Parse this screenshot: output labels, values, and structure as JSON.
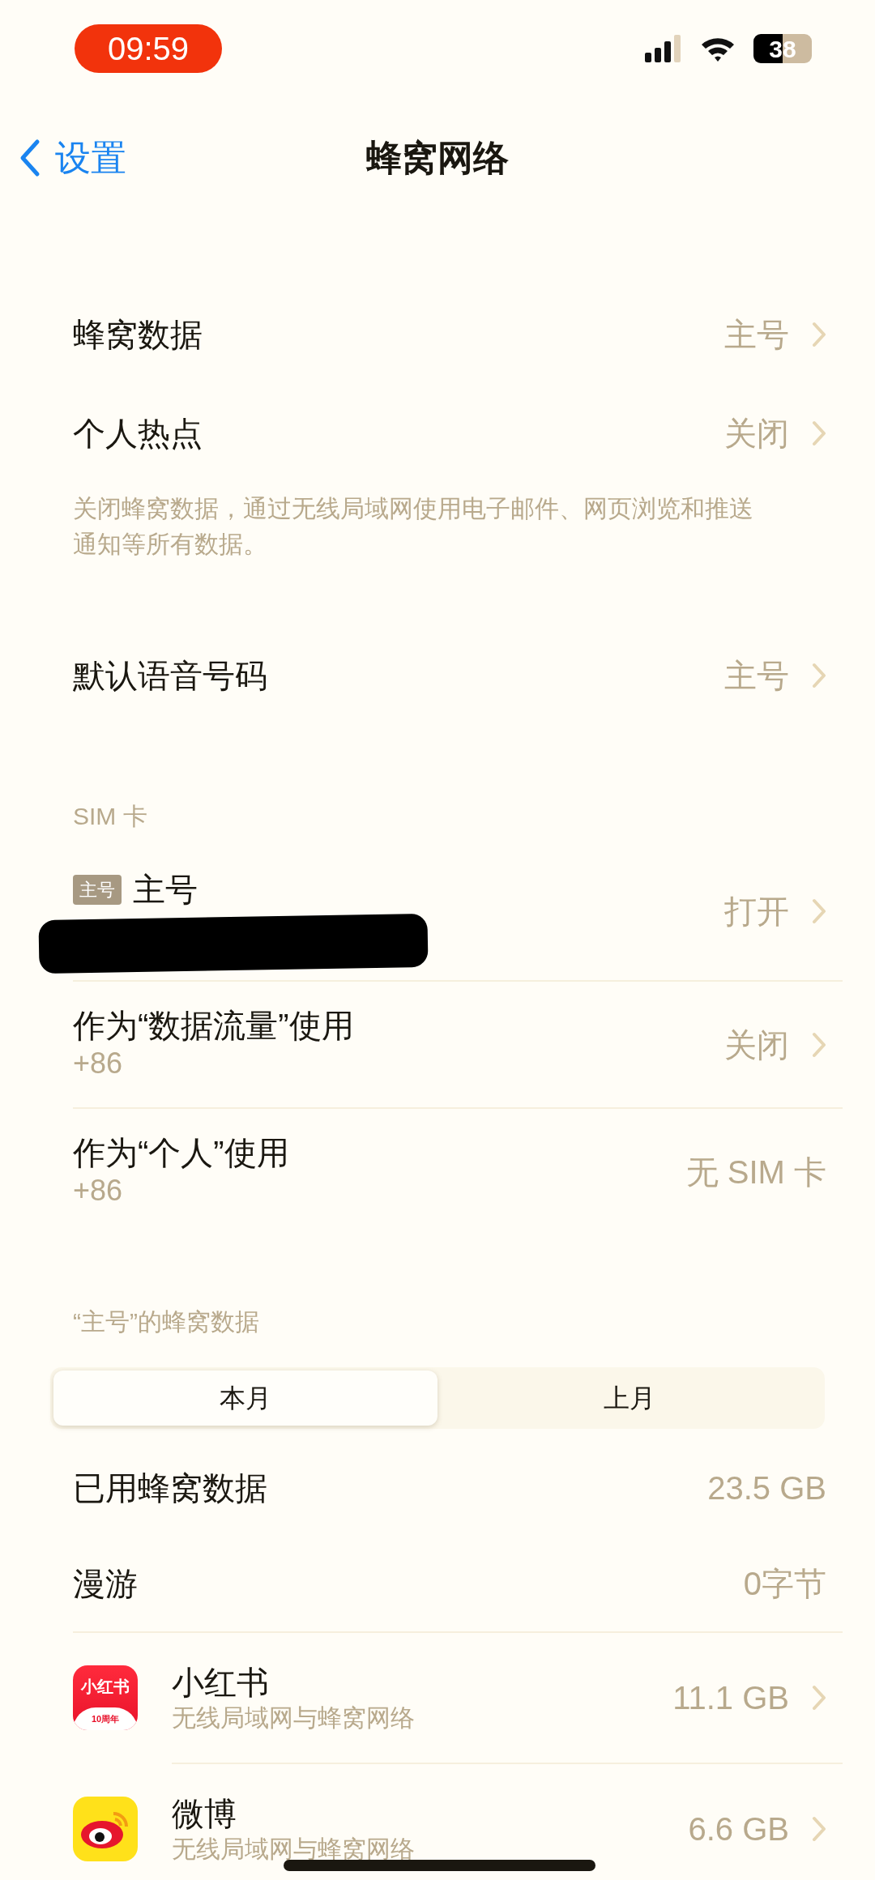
{
  "status_bar": {
    "time": "09:59",
    "battery": "38"
  },
  "nav": {
    "back": "设置",
    "title": "蜂窝网络"
  },
  "sections": [
    {
      "rows": [
        {
          "kind": "setting",
          "label": "蜂窝数据",
          "value": "主号",
          "chevron": true
        },
        {
          "kind": "setting",
          "label": "个人热点",
          "value": "关闭",
          "chevron": true
        }
      ],
      "footer": "关闭蜂窝数据，通过无线局域网使用电子邮件、网页浏览和推送通知等所有数据。"
    },
    {
      "rows": [
        {
          "kind": "setting",
          "label": "默认语音号码",
          "value": "主号",
          "chevron": true
        }
      ]
    },
    {
      "header": "SIM 卡",
      "rows": [
        {
          "kind": "sim",
          "badge": "主号",
          "label": "主号",
          "value": "打开",
          "chevron": true
        },
        {
          "kind": "setting",
          "label": "作为“数据流量”使用",
          "sublabel": "+86",
          "value": "关闭",
          "chevron": true
        },
        {
          "kind": "setting",
          "label": "作为“个人”使用",
          "sublabel": "+86",
          "value": "无 SIM 卡",
          "chevron": false
        }
      ]
    },
    {
      "header": "“主号”的蜂窝数据",
      "segments": [
        {
          "label": "本月",
          "selected": true
        },
        {
          "label": "上月",
          "selected": false
        }
      ],
      "rows": [
        {
          "kind": "setting",
          "label": "已用蜂窝数据",
          "value": "23.5 GB",
          "chevron": false
        },
        {
          "kind": "setting",
          "label": "漫游",
          "value": "0字节",
          "chevron": false
        },
        {
          "kind": "redapp",
          "icon_text": "小红书",
          "icon_subtext": "10周年",
          "label": "小红书",
          "sublabel": "无线局域网与蜂窝网络",
          "value": "11.1 GB",
          "chevron": true
        },
        {
          "kind": "eyeapp",
          "label": "微博",
          "sublabel": "无线局域网与蜂窝网络",
          "value": "6.6 GB",
          "chevron": true
        }
      ]
    }
  ]
}
